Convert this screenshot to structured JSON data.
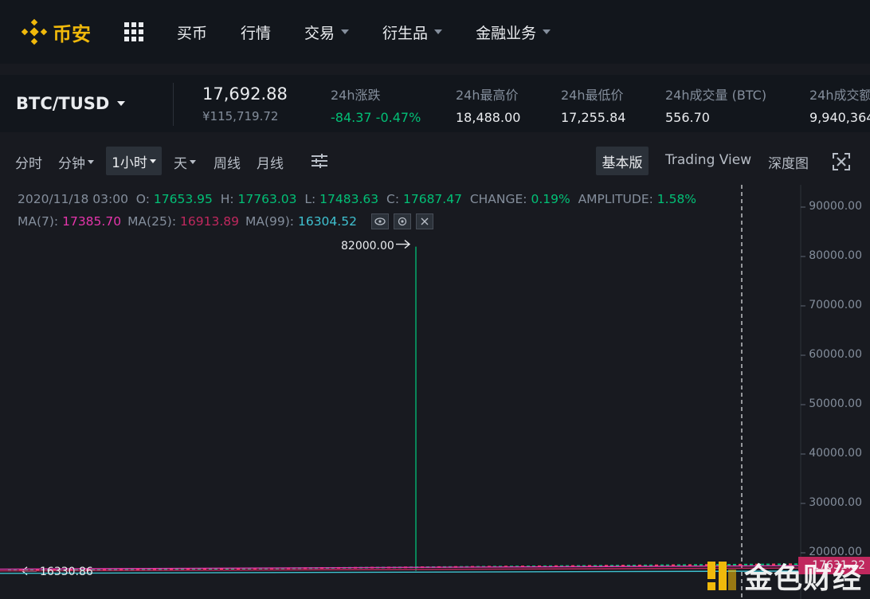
{
  "nav": {
    "brand": "币安",
    "items": [
      {
        "label": "买币",
        "has_caret": false
      },
      {
        "label": "行情",
        "has_caret": false
      },
      {
        "label": "交易",
        "has_caret": true
      },
      {
        "label": "衍生品",
        "has_caret": true
      },
      {
        "label": "金融业务",
        "has_caret": true
      }
    ]
  },
  "ticker": {
    "pair": "BTC/TUSD",
    "last_price": "17,692.88",
    "last_price_cny": "¥115,719.72",
    "stats": [
      {
        "label": "24h涨跌",
        "value": "-84.37 -0.47%"
      },
      {
        "label": "24h最高价",
        "value": "18,488.00"
      },
      {
        "label": "24h最低价",
        "value": "17,255.84"
      },
      {
        "label": "24h成交量 (BTC)",
        "value": "556.70"
      },
      {
        "label": "24h成交额",
        "value": "9,940,364"
      }
    ]
  },
  "toolbar": {
    "intervals": [
      "分时",
      "分钟",
      "1小时",
      "天",
      "周线",
      "月线"
    ],
    "active_interval": "1小时",
    "views": [
      "基本版",
      "Trading View",
      "深度图"
    ],
    "active_view": "基本版"
  },
  "chart": {
    "ohlc": {
      "date": "2020/11/18 03:00",
      "o_label": "O:",
      "o": "17653.95",
      "h_label": "H:",
      "h": "17763.03",
      "l_label": "L:",
      "l": "17483.63",
      "c_label": "C:",
      "c": "17687.47",
      "change_label": "CHANGE:",
      "change": "0.19%",
      "amplitude_label": "AMPLITUDE:",
      "amplitude": "1.58%"
    },
    "ma": {
      "ma7_label": "MA(7):",
      "ma7": "17385.70",
      "ma25_label": "MA(25):",
      "ma25": "16913.89",
      "ma99_label": "MA(99):",
      "ma99": "16304.52"
    },
    "peak_label": "82000.00",
    "low_label": "16330.86",
    "current_price_tag": "17631.22",
    "colors": {
      "up": "#02c076",
      "down": "#f6465d",
      "ma7": "#e535ab",
      "ma25": "#c0285e",
      "ma99": "#3fc1d0"
    }
  },
  "chart_data": {
    "type": "line",
    "y_axis_ticks": [
      "90000.00",
      "80000.00",
      "70000.00",
      "60000.00",
      "50000.00",
      "40000.00",
      "30000.00",
      "20000.00"
    ],
    "ylim": [
      15000,
      92000
    ],
    "spike_high": 82000,
    "low": 16330.86,
    "series": [
      {
        "name": "MA(7)",
        "values": [
          17385.7
        ]
      },
      {
        "name": "MA(25)",
        "values": [
          16913.89
        ]
      },
      {
        "name": "MA(99)",
        "values": [
          16304.52
        ]
      }
    ]
  },
  "watermark": {
    "text": "金色财经"
  }
}
